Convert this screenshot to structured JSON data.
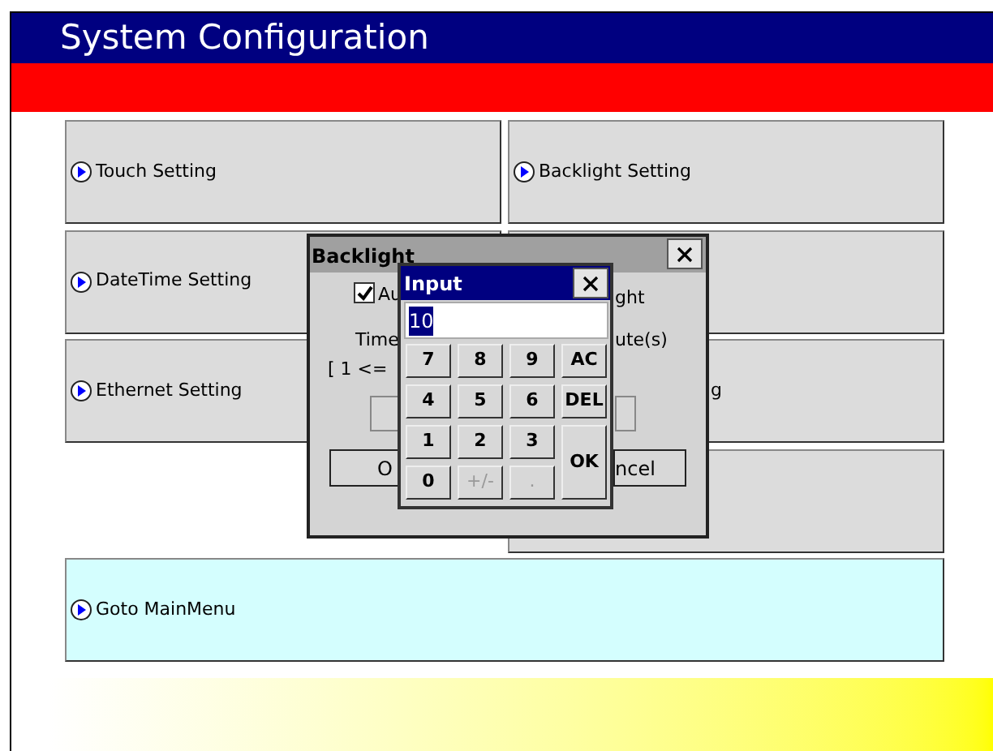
{
  "header": {
    "title": "System Configuration"
  },
  "menu_buttons": [
    {
      "label": "Touch Setting",
      "kind": "normal"
    },
    {
      "label": "Backlight Setting",
      "kind": "normal"
    },
    {
      "label": "DateTime Setting",
      "kind": "normal"
    },
    {
      "kind": "covered"
    },
    {
      "label": "Ethernet Setting",
      "kind": "normal"
    },
    {
      "label": "g",
      "kind": "partial"
    },
    {
      "kind": "empty"
    },
    {
      "kind": "covered"
    },
    {
      "label": "Goto MainMenu",
      "kind": "wide"
    }
  ],
  "backlight_dialog": {
    "title": "Backlight",
    "checkbox": {
      "label": "Au",
      "checked": true
    },
    "label_right": "ght",
    "time_label": "Time",
    "unit_label": "ute(s)",
    "range_label": "[ 1 <=",
    "ok_button": "O",
    "cancel_button": "ncel"
  },
  "input_dialog": {
    "title": "Input",
    "field": {
      "value": "10",
      "text_selected": true
    },
    "keys": [
      {
        "label": "7",
        "disabled": false,
        "kind": "key"
      },
      {
        "label": "8",
        "disabled": false,
        "kind": "key"
      },
      {
        "label": "9",
        "disabled": false,
        "kind": "key"
      },
      {
        "label": "AC",
        "disabled": false,
        "kind": "key"
      },
      {
        "label": "4",
        "disabled": false,
        "kind": "key"
      },
      {
        "label": "5",
        "disabled": false,
        "kind": "key"
      },
      {
        "label": "6",
        "disabled": false,
        "kind": "key"
      },
      {
        "label": "DEL",
        "disabled": false,
        "kind": "key"
      },
      {
        "label": "1",
        "disabled": false,
        "kind": "key"
      },
      {
        "label": "2",
        "disabled": false,
        "kind": "key"
      },
      {
        "label": "3",
        "disabled": false,
        "kind": "key"
      },
      {
        "label": "OK",
        "disabled": false,
        "kind": "tall"
      },
      {
        "label": "0",
        "disabled": false,
        "kind": "key"
      },
      {
        "label": "+/-",
        "disabled": true,
        "kind": "key"
      },
      {
        "label": ".",
        "disabled": true,
        "kind": "key"
      }
    ]
  }
}
